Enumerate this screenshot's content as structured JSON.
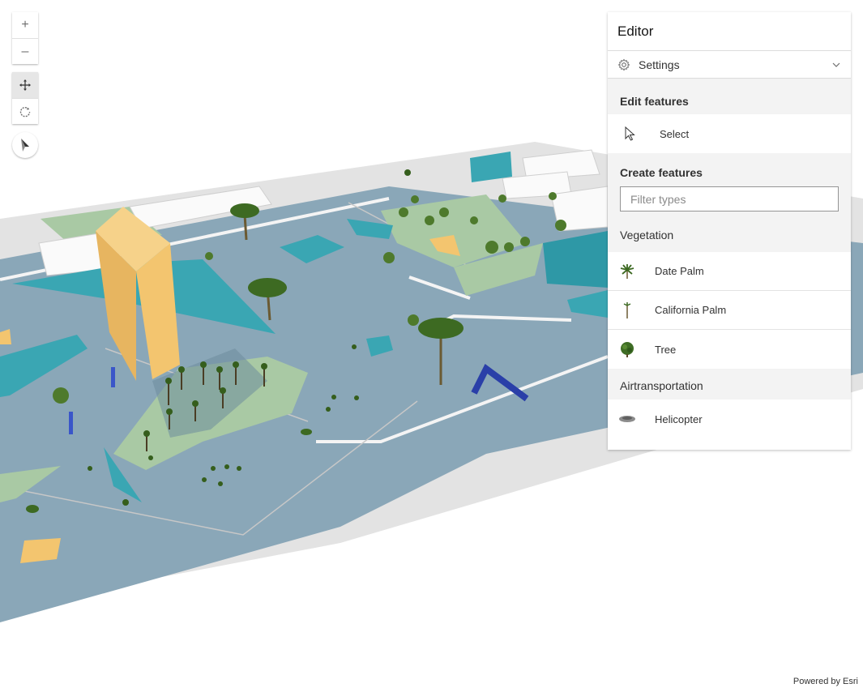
{
  "map": {
    "zoom_in_label": "+",
    "zoom_out_label": "–"
  },
  "editor": {
    "title": "Editor",
    "settings_label": "Settings",
    "edit_section_title": "Edit features",
    "select_label": "Select",
    "create_section_title": "Create features",
    "filter_placeholder": "Filter types",
    "groups": [
      {
        "name": "Vegetation",
        "items": [
          {
            "label": "Date Palm",
            "icon": "date-palm-icon"
          },
          {
            "label": "California Palm",
            "icon": "california-palm-icon"
          },
          {
            "label": "Tree",
            "icon": "tree-icon"
          }
        ]
      },
      {
        "name": "Airtransportation",
        "items": [
          {
            "label": "Helicopter",
            "icon": "helicopter-icon"
          }
        ]
      }
    ]
  },
  "attribution": "Powered by Esri",
  "colors": {
    "ground_blue": "#8aa7b8",
    "park_green": "#a9c9a4",
    "building_teal": "#3aa6b3",
    "tower_orange": "#f3c56f",
    "panel_gray": "#f3f3f3"
  }
}
